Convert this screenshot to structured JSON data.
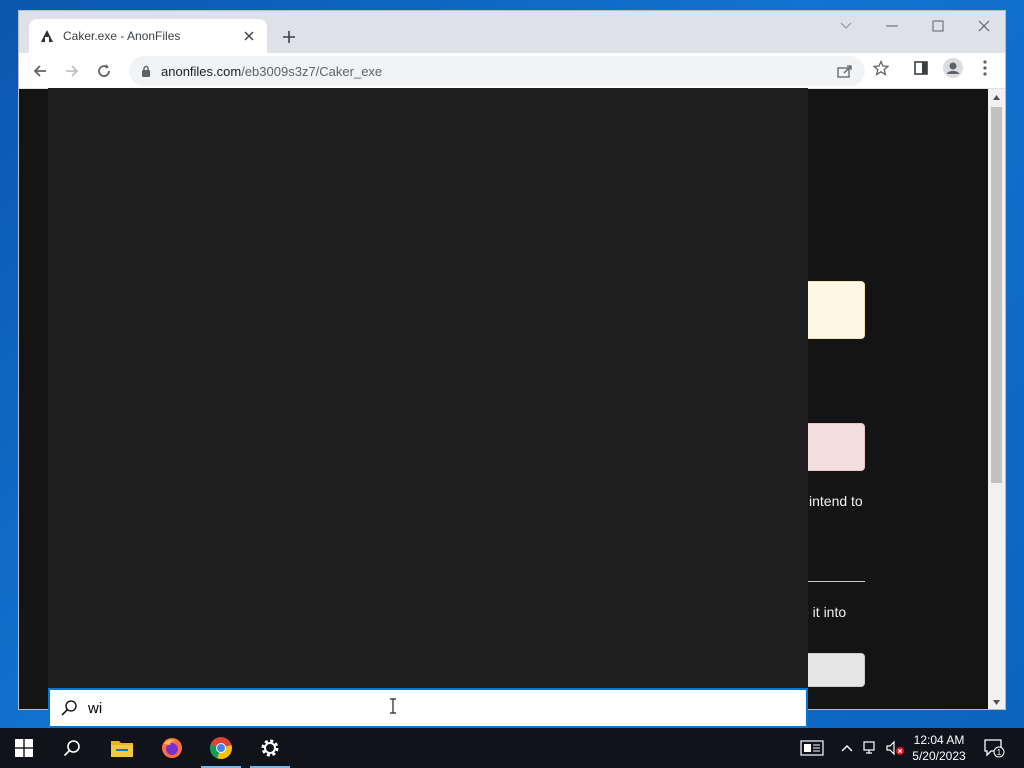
{
  "browser": {
    "tab": {
      "title": "Caker.exe - AnonFiles",
      "favicon": "anonfiles-logo-icon"
    },
    "url": {
      "domain": "anonfiles.com",
      "path": "/eb3009s3z7/Caker_exe"
    }
  },
  "page": {
    "text_fragment_1": "intend to",
    "text_fragment_2": "e it into"
  },
  "search": {
    "query": "wi",
    "icon": "search-icon"
  },
  "taskbar": {
    "items": [
      "windows-start-icon",
      "search-icon",
      "file-explorer-icon",
      "firefox-icon",
      "chrome-icon",
      "settings-icon"
    ],
    "clock": {
      "time": "12:04 AM",
      "date": "5/20/2023"
    },
    "notification_count": "1"
  },
  "colors": {
    "accent": "#0078d7",
    "search_panel_bg": "#1f1f1f",
    "taskbar_bg": "#10131a"
  }
}
